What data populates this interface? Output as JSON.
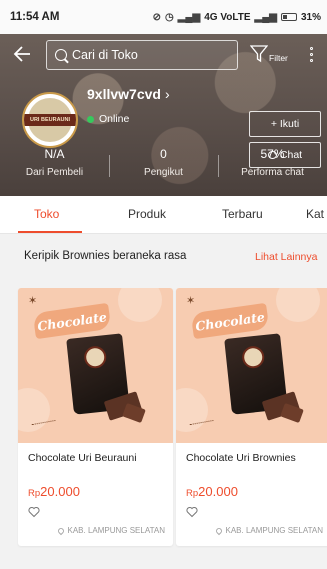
{
  "status_bar": {
    "time": "11:54 AM",
    "network": "4G VoLTE",
    "battery": "31%"
  },
  "header": {
    "search_placeholder": "Cari di Toko",
    "filter_label": "Filter",
    "shop_name": "9xllvw7cvd",
    "status": "Online",
    "follow_label": "+ Ikuti",
    "chat_label": "Chat",
    "avatar_text": "URI BEURAUNI",
    "stats": [
      {
        "value": "N/A",
        "label": "Dari Pembeli"
      },
      {
        "value": "0",
        "label": "Pengikut"
      },
      {
        "value": "57%",
        "label": "Performa chat"
      }
    ]
  },
  "tabs": [
    {
      "label": "Toko",
      "active": true
    },
    {
      "label": "Produk",
      "active": false
    },
    {
      "label": "Terbaru",
      "active": false
    },
    {
      "label": "Kat",
      "active": false
    }
  ],
  "section": {
    "title": "Keripik Brownies beraneka rasa",
    "link": "Lihat Lainnya"
  },
  "products": [
    {
      "name": "Chocolate Uri Beurauni",
      "currency": "Rp",
      "price": "20.000",
      "location": "KAB. LAMPUNG SELATAN",
      "image_title": "Chocolate"
    },
    {
      "name": "Chocolate Uri Brownies",
      "currency": "Rp",
      "price": "20.000",
      "location": "KAB. LAMPUNG SELATAN",
      "image_title": "Chocolate"
    }
  ],
  "colors": {
    "accent": "#ee4d2d",
    "online": "#36c95d"
  }
}
